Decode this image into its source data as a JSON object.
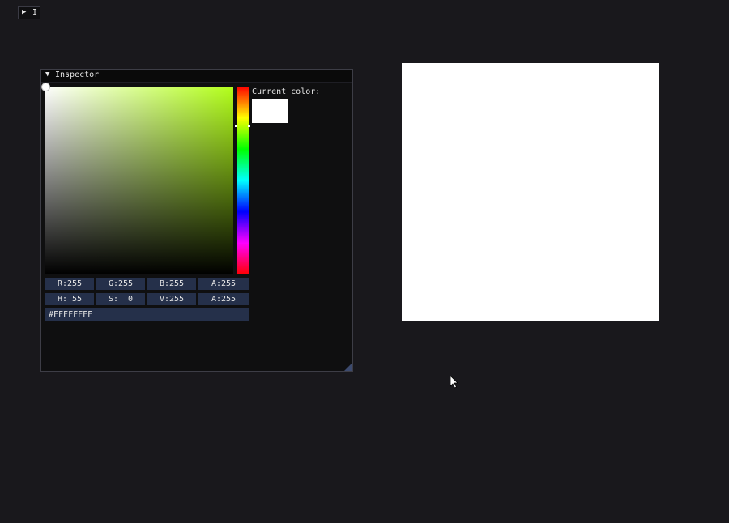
{
  "collapsed_window": {
    "arrow": "▶",
    "title": "I"
  },
  "inspector": {
    "arrow": "▼",
    "title": "Inspector",
    "current_color_label": "Current color:",
    "current_color": "#ffffff",
    "rgba_fields": [
      "R:255",
      "G:255",
      "B:255",
      "A:255"
    ],
    "hsva_fields": [
      "H: 55",
      "S:  0",
      "V:255",
      "A:255"
    ],
    "hex_value": "#FFFFFFFF"
  },
  "colors": {
    "background": "#19181c",
    "window_bg": "#0f0f10",
    "field_bg": "#25304a",
    "hue_color": "#b3ff1a",
    "preview": "#ffffff"
  },
  "icons": {
    "collapse": "triangle-down-icon",
    "expand": "triangle-right-icon",
    "cursor": "mouse-pointer-icon"
  }
}
